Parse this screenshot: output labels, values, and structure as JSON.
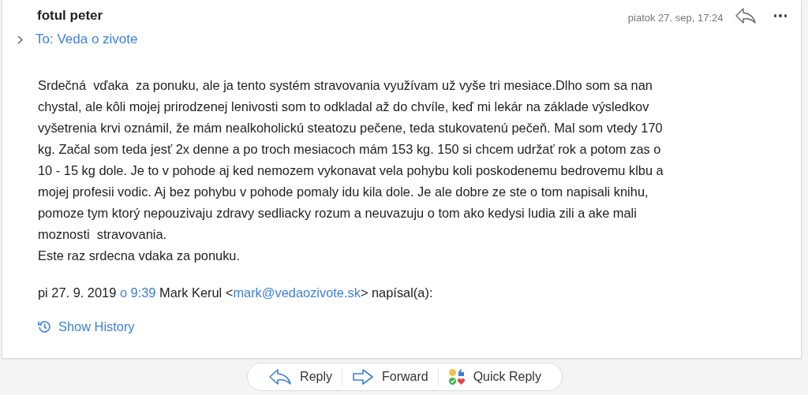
{
  "message": {
    "sender": "fotul peter",
    "date": "piatok 27. sep, 17:24",
    "recipient": "To: Veda o zivote",
    "expanded": false,
    "body_lines": [
      "Srdečná  vďaka  za ponuku, ale ja tento systém stravovania využívam už vyše tri mesiace.Dlho som sa nan",
      "chystal, ale kôli mojej prirodzenej lenivosti som to odkladal až do chvíle, keď mi lekár na základe výsledkov",
      "vyšetrenia krvi oznámil, že mám nealkoholickú steatozu pečene, teda stukovatenú pečeň. Mal som vtedy 170",
      "kg. Začal som teda jesť 2x denne a po troch mesiacoch mám 153 kg. 150 si chcem udržať rok a potom zas o",
      "10 - 15 kg dole. Je to v pohode aj ked nemozem vykonavat vela pohybu koli poskodenemu bedrovemu klbu a",
      "mojej profesii vodic. Aj bez pohybu v pohode pomaly idu kila dole. Je ale dobre ze ste o tom napisali knihu,",
      "pomoze tym ktorý nepouzivaju zdravy sedliacky rozum a neuvazuju o tom ako kedysi ludia zili a ake mali",
      "moznosti  stravovania.",
      "Este raz srdecna vdaka za ponuku."
    ],
    "attribution": [
      {
        "kind": "text",
        "text": "pi 27. 9. 2019 "
      },
      {
        "kind": "link",
        "text": "o 9:39"
      },
      {
        "kind": "text",
        "text": " Mark Kerul <"
      },
      {
        "kind": "link",
        "text": "mark@vedaozivote.sk"
      },
      {
        "kind": "text",
        "text": "> napísal(a):"
      }
    ],
    "show_history": "Show History"
  },
  "actions": [
    {
      "kind": "reply",
      "label": "Reply"
    },
    {
      "kind": "forward",
      "label": "Forward"
    },
    {
      "kind": "quick",
      "label": "Quick Reply"
    }
  ]
}
